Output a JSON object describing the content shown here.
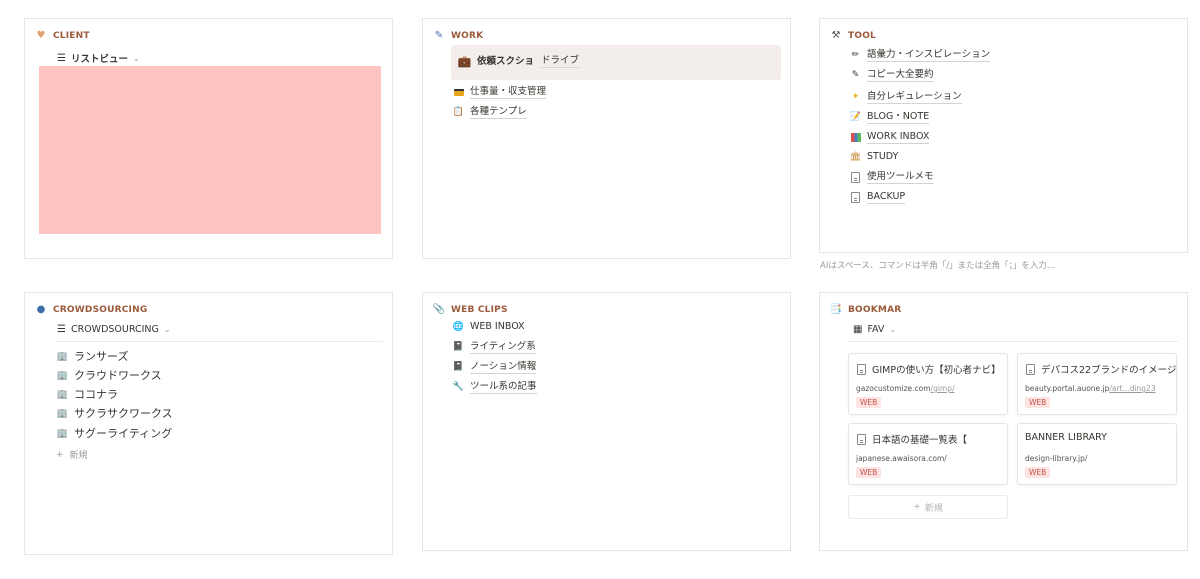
{
  "client": {
    "title": "CLIENT",
    "view_label": "リストビュー",
    "colors": {
      "block": "#ffc4c1"
    }
  },
  "work": {
    "title": "WORK",
    "highlight": {
      "main": "依頼スクショ",
      "link": "ドライブ"
    },
    "items": [
      {
        "icon": "credit-card-icon",
        "label": "仕事量・収支管理"
      },
      {
        "icon": "clipboard-icon",
        "label": "各種テンプレ"
      }
    ]
  },
  "tool": {
    "title": "TOOL",
    "items": [
      {
        "icon": "pencil-icon",
        "label": "語彙力・インスピレーション"
      },
      {
        "icon": "edit-lines-icon",
        "label": "コピー大全要約"
      },
      {
        "icon": "sparkle-icon",
        "label": "自分レギュレーション"
      },
      {
        "icon": "memo-icon",
        "label": "BLOG・NOTE"
      },
      {
        "icon": "books-icon",
        "label": "WORK INBOX"
      },
      {
        "icon": "bank-icon",
        "label": "STUDY"
      },
      {
        "icon": "document-icon",
        "label": "使用ツールメモ"
      },
      {
        "icon": "document-icon",
        "label": "BACKUP"
      }
    ],
    "hint": "AIはスペース、コマンドは半角「/」または全角「；」を入力..."
  },
  "crowdsourcing": {
    "title": "CROWDSOURCING",
    "view_label": "CROWDSOURCING",
    "items": [
      {
        "label": "ランサーズ"
      },
      {
        "label": "クラウドワークス"
      },
      {
        "label": "ココナラ"
      },
      {
        "label": "サクラサクワークス"
      },
      {
        "label": "サグーライティング"
      }
    ],
    "new_label": "新規"
  },
  "web_clips": {
    "title": "WEB CLIPS",
    "items": [
      {
        "icon": "globe-icon",
        "label": "WEB INBOX"
      },
      {
        "icon": "notebook-icon",
        "label": "ライティング系"
      },
      {
        "icon": "notebook-icon",
        "label": "ノーション情報"
      },
      {
        "icon": "wrench-icon",
        "label": "ツール系の記事"
      }
    ]
  },
  "bookmark": {
    "title": "BOOKMAR",
    "view_label": "FAV",
    "cards": [
      {
        "title": "GIMPの使い方【初心者ナビ】",
        "url": "gazocustomize.com",
        "url_dim": "/gimp/",
        "tag": "WEB",
        "has_icon": true
      },
      {
        "title": "デパコス22ブランドのイメージ",
        "url": "beauty.portal.auone.jp",
        "url_dim": "/art...ding23",
        "tag": "WEB",
        "has_icon": true
      },
      {
        "title": "日本語の基礎一覧表【",
        "url": "japanese.awaisora.com/",
        "url_dim": "",
        "tag": "WEB",
        "has_icon": true
      },
      {
        "title": "BANNER LIBRARY",
        "url": "design-library.jp/",
        "url_dim": "",
        "tag": "WEB",
        "has_icon": false
      }
    ],
    "new_label": "新規"
  }
}
